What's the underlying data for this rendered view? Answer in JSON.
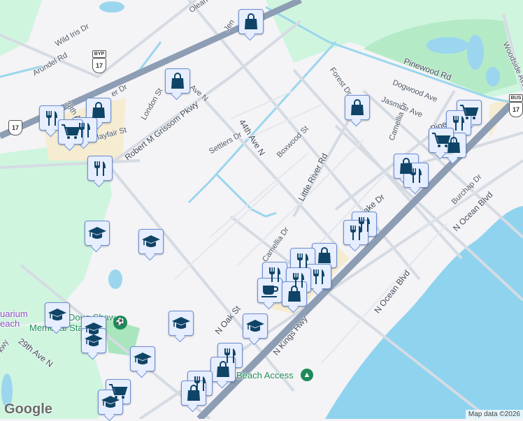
{
  "map": {
    "colors": {
      "land": "#f4f3f6",
      "park": "#cff5df",
      "golf": "#b5eac6",
      "water": "#9bd6ee",
      "highway": "#8d9db3",
      "road": "#d5dbe3",
      "sand": "#f6ecd1",
      "marker": "#0f4466"
    },
    "labels": {
      "wild_iris": "Wild Iris Dr",
      "arundel": "Arundel Rd",
      "ave38": "38th A",
      "er_dr": "er Dr",
      "london": "London St",
      "ave_n": "Ave N",
      "mayfair": "Mayfair St",
      "grissom": "Robert M Grissom Pkwy",
      "settlers": "Settlers Dr",
      "boxwood": "Boxwood St",
      "ave44": "44th Ave N",
      "forest": "Forest Dr",
      "dogwood": "Dogwood Ave",
      "jasmine": "Jasmine Ave",
      "camellia1": "Camellia Dr",
      "pinewood": "Pinewood Rd",
      "woodside": "Woodside Ave",
      "little_river": "Little River Rd",
      "pine_lake": "Pine Lake Dr",
      "burchap": "Burchap Dr",
      "ocean1": "N Ocean Blvd",
      "ocean2": "N Ocean Blvd",
      "oak": "N Oak St",
      "camellia2": "Camellia Dr",
      "kings": "N Kings Hwy",
      "ave29": "29th Ave N",
      "olean": "Olean",
      "jen": "Jen",
      "kwy": "kwy",
      "pine_short": "Pine",
      "beach_access": "Beach Access",
      "stadium1": "Doug Shaw",
      "stadium2": "Memorial Stadium",
      "aquarium1": "uarium",
      "aquarium2": "each"
    },
    "shields": {
      "byp": "17",
      "us17a": "17",
      "bus17": "17",
      "byp_tag": "BYP",
      "bus_tag": "BUS"
    },
    "marker_types": {
      "shopping": "shopping-bag-icon",
      "restaurant": "restaurant-icon",
      "cart": "shopping-cart-icon",
      "school": "school-icon",
      "coffee": "coffee-icon"
    },
    "google_logo": "Google",
    "attribution": "Map data ©2026"
  }
}
